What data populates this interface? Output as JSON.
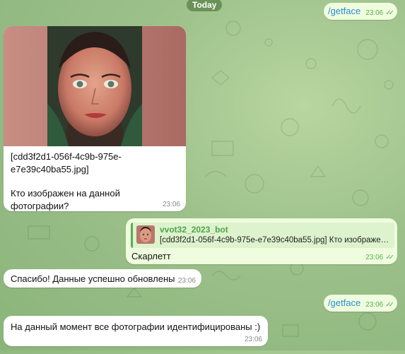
{
  "date_label": "Today",
  "messages": {
    "cmd1": {
      "text": "/getface",
      "time": "23:06"
    },
    "photo": {
      "caption_line1": "[cdd3f2d1-056f-4c9b-975e-",
      "caption_line2": "e7e39c40ba55.jpg]",
      "question": "Кто изображен на данной фотографии?",
      "time": "23:06"
    },
    "reply": {
      "quoted_name": "vvot32_2023_bot",
      "quoted_text": "[cdd3f2d1-056f-4c9b-975e-e7e39c40ba55.jpg] Кто изображен ...",
      "body": "Скарлетт",
      "time": "23:06"
    },
    "thanks": {
      "text": "Спасибо! Данные успешно обновлены",
      "time": "23:06"
    },
    "cmd2": {
      "text": "/getface",
      "time": "23:06"
    },
    "final": {
      "text": "На данный момент все фотографии идентифицированы :)",
      "time": "23:06"
    }
  },
  "icons": {
    "read_receipt": "double-check-icon"
  },
  "colors": {
    "outgoing_bubble": "#effdde",
    "incoming_bubble": "#ffffff",
    "accent_green": "#5ea955",
    "command_blue": "#2a8bd6"
  }
}
